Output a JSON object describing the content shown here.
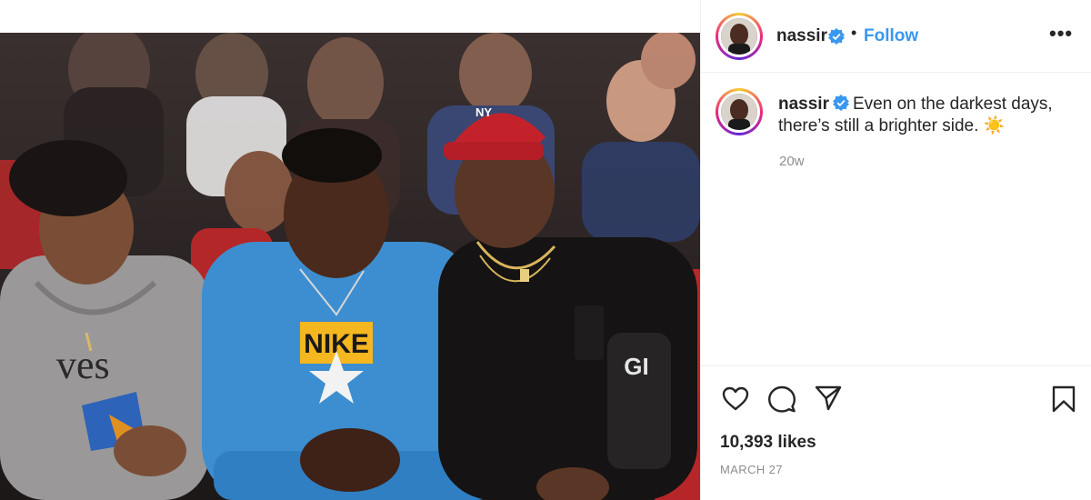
{
  "post": {
    "username": "nassir",
    "follow_label": "Follow",
    "dot": "•",
    "more_label": "•••",
    "caption": "Even on the darkest days, there’s still a brighter side.",
    "caption_emoji": "☀️",
    "time_ago": "20w",
    "likes": "10,393 likes",
    "date": "MARCH 27"
  },
  "photo": {
    "shirt_text": "NIKE",
    "hoodie_text": "ves",
    "cap_logo": "NY",
    "seat_text": "GI"
  },
  "icons": {
    "verified": "verified-badge-icon",
    "like": "heart-icon",
    "comment": "comment-icon",
    "share": "paper-plane-icon",
    "save": "bookmark-icon"
  },
  "colors": {
    "link": "#3897f0",
    "verified": "#3897f0",
    "muted": "#8e8e8e",
    "text": "#262626"
  }
}
